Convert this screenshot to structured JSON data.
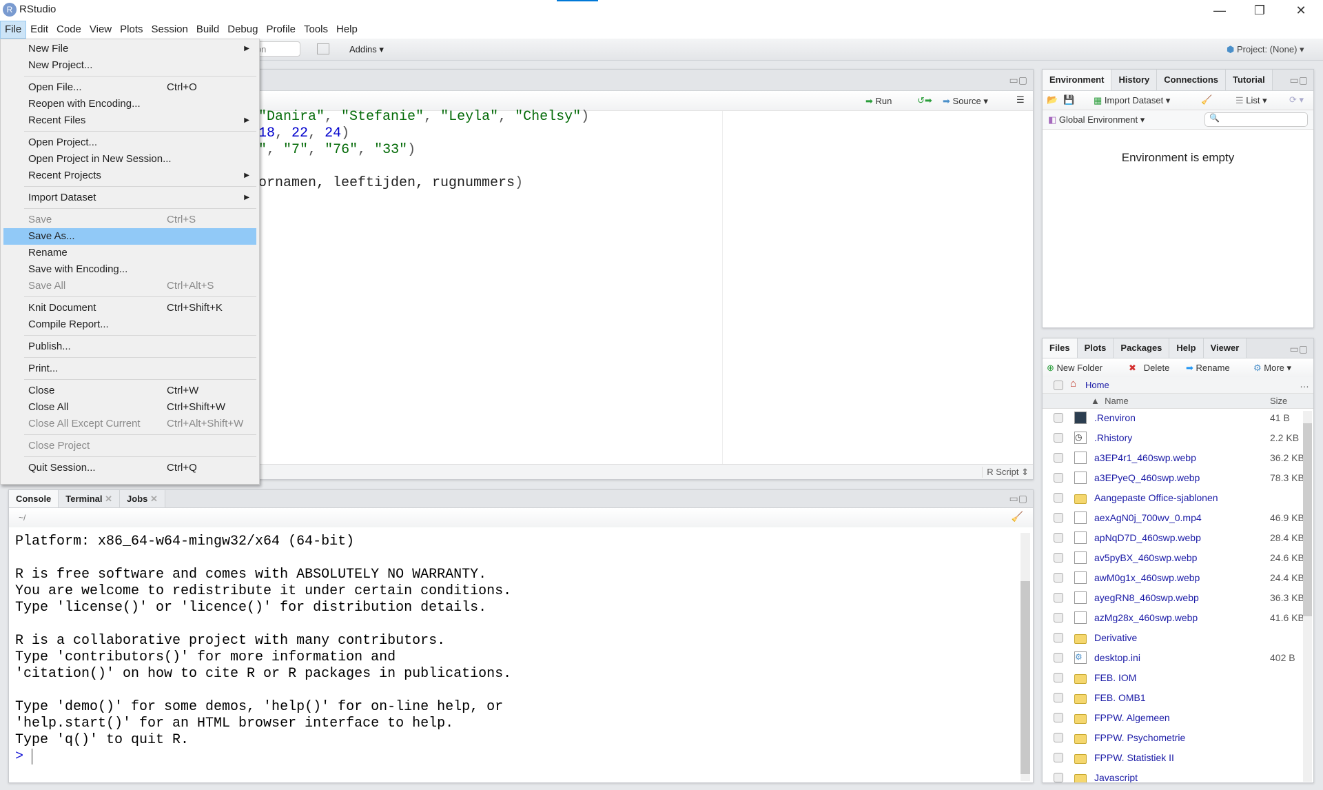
{
  "window": {
    "title": "RStudio",
    "logo": "R"
  },
  "menubar": [
    "File",
    "Edit",
    "Code",
    "View",
    "Plots",
    "Session",
    "Build",
    "Debug",
    "Profile",
    "Tools",
    "Help"
  ],
  "toolbar": {
    "goto_partial": "ion",
    "addins": "Addins",
    "project": "Project: (None)"
  },
  "file_menu": [
    {
      "label": "New File",
      "submenu": true
    },
    {
      "label": "New Project..."
    },
    {
      "sep": true
    },
    {
      "label": "Open File...",
      "shortcut": "Ctrl+O"
    },
    {
      "label": "Reopen with Encoding..."
    },
    {
      "label": "Recent Files",
      "submenu": true
    },
    {
      "sep": true
    },
    {
      "label": "Open Project..."
    },
    {
      "label": "Open Project in New Session..."
    },
    {
      "label": "Recent Projects",
      "submenu": true
    },
    {
      "sep": true
    },
    {
      "label": "Import Dataset",
      "submenu": true
    },
    {
      "sep": true
    },
    {
      "label": "Save",
      "shortcut": "Ctrl+S",
      "disabled": true
    },
    {
      "label": "Save As...",
      "highlighted": true
    },
    {
      "label": "Rename"
    },
    {
      "label": "Save with Encoding..."
    },
    {
      "label": "Save All",
      "shortcut": "Ctrl+Alt+S",
      "disabled": true
    },
    {
      "sep": true
    },
    {
      "label": "Knit Document",
      "shortcut": "Ctrl+Shift+K"
    },
    {
      "label": "Compile Report..."
    },
    {
      "sep": true
    },
    {
      "label": "Publish..."
    },
    {
      "sep": true
    },
    {
      "label": "Print..."
    },
    {
      "sep": true
    },
    {
      "label": "Close",
      "shortcut": "Ctrl+W"
    },
    {
      "label": "Close All",
      "shortcut": "Ctrl+Shift+W"
    },
    {
      "label": "Close All Except Current",
      "shortcut": "Ctrl+Alt+Shift+W",
      "disabled": true
    },
    {
      "sep": true
    },
    {
      "label": "Close Project",
      "disabled": true
    },
    {
      "sep": true
    },
    {
      "label": "Quit Session...",
      "shortcut": "Ctrl+Q"
    }
  ],
  "editor": {
    "run": "Run",
    "source": "Source",
    "file_type": "R Script",
    "lines": [
      [
        [
          "str",
          "\"Danira\""
        ],
        [
          "pun",
          ", "
        ],
        [
          "str",
          "\"Stefanie\""
        ],
        [
          "pun",
          ", "
        ],
        [
          "str",
          "\"Leyla\""
        ],
        [
          "pun",
          ", "
        ],
        [
          "str",
          "\"Chelsy\""
        ],
        [
          "pun",
          ")"
        ]
      ],
      [
        [
          "num",
          "18"
        ],
        [
          "pun",
          ", "
        ],
        [
          "num",
          "22"
        ],
        [
          "pun",
          ", "
        ],
        [
          "num",
          "24"
        ],
        [
          "pun",
          ")"
        ]
      ],
      [
        [
          "str",
          "\""
        ],
        [
          "pun",
          ", "
        ],
        [
          "str",
          "\"7\""
        ],
        [
          "pun",
          ", "
        ],
        [
          "str",
          "\"76\""
        ],
        [
          "pun",
          ", "
        ],
        [
          "str",
          "\"33\""
        ],
        [
          "pun",
          ")"
        ]
      ],
      [],
      [
        [
          "txt",
          "ornamen, leeftijden, rugnummers"
        ],
        [
          "pun",
          ")"
        ]
      ]
    ]
  },
  "console": {
    "tabs": [
      "Console",
      "Terminal",
      "Jobs"
    ],
    "path": "~/",
    "prompt": ">",
    "lines": [
      "Platform: x86_64-w64-mingw32/x64 (64-bit)",
      "",
      "R is free software and comes with ABSOLUTELY NO WARRANTY.",
      "You are welcome to redistribute it under certain conditions.",
      "Type 'license()' or 'licence()' for distribution details.",
      "",
      "R is a collaborative project with many contributors.",
      "Type 'contributors()' for more information and",
      "'citation()' on how to cite R or R packages in publications.",
      "",
      "Type 'demo()' for some demos, 'help()' for on-line help, or",
      "'help.start()' for an HTML browser interface to help.",
      "Type 'q()' to quit R."
    ]
  },
  "environment": {
    "tabs": [
      "Environment",
      "History",
      "Connections",
      "Tutorial"
    ],
    "import_dataset": "Import Dataset",
    "list": "List",
    "scope": "Global Environment",
    "empty_message": "Environment is empty"
  },
  "files": {
    "tabs": [
      "Files",
      "Plots",
      "Packages",
      "Help",
      "Viewer"
    ],
    "new_folder": "New Folder",
    "delete": "Delete",
    "rename": "Rename",
    "more": "More",
    "breadcrumb": "Home",
    "col_name": "Name",
    "col_size": "Size",
    "rows": [
      {
        "name": ".Renviron",
        "size": "41 B",
        "type": "renviron"
      },
      {
        "name": ".Rhistory",
        "size": "2.2 KB",
        "type": "history"
      },
      {
        "name": "a3EP4r1_460swp.webp",
        "size": "36.2 KB",
        "type": "file"
      },
      {
        "name": "a3EPyeQ_460swp.webp",
        "size": "78.3 KB",
        "type": "file"
      },
      {
        "name": "Aangepaste Office-sjablonen",
        "size": "",
        "type": "folder"
      },
      {
        "name": "aexAgN0j_700wv_0.mp4",
        "size": "46.9 KB",
        "type": "file"
      },
      {
        "name": "apNqD7D_460swp.webp",
        "size": "28.4 KB",
        "type": "file"
      },
      {
        "name": "av5pyBX_460swp.webp",
        "size": "24.6 KB",
        "type": "file"
      },
      {
        "name": "awM0g1x_460swp.webp",
        "size": "24.4 KB",
        "type": "file"
      },
      {
        "name": "ayegRN8_460swp.webp",
        "size": "36.3 KB",
        "type": "file"
      },
      {
        "name": "azMg28x_460swp.webp",
        "size": "41.6 KB",
        "type": "file"
      },
      {
        "name": "Derivative",
        "size": "",
        "type": "folder"
      },
      {
        "name": "desktop.ini",
        "size": "402 B",
        "type": "settings"
      },
      {
        "name": "FEB. IOM",
        "size": "",
        "type": "folder"
      },
      {
        "name": "FEB. OMB1",
        "size": "",
        "type": "folder"
      },
      {
        "name": "FPPW. Algemeen",
        "size": "",
        "type": "folder"
      },
      {
        "name": "FPPW. Psychometrie",
        "size": "",
        "type": "folder"
      },
      {
        "name": "FPPW. Statistiek II",
        "size": "",
        "type": "folder"
      },
      {
        "name": "Javascript",
        "size": "",
        "type": "folder"
      }
    ]
  }
}
